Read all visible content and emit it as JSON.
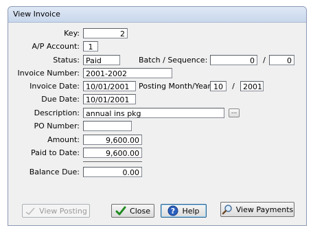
{
  "window": {
    "title": "View Invoice"
  },
  "labels": {
    "key": "Key:",
    "ap_account": "A/P Account:",
    "status": "Status:",
    "batch_sequence": "Batch / Sequence:",
    "slash": "/",
    "invoice_number": "Invoice Number:",
    "invoice_date": "Invoice Date:",
    "posting_month_year": "Posting Month/Year:",
    "due_date": "Due Date:",
    "description": "Description:",
    "po_number": "PO Number:",
    "amount": "Amount:",
    "paid_to_date": "Paid to Date:",
    "balance_due": "Balance Due:"
  },
  "values": {
    "key": "2",
    "ap_account": "1",
    "status": "Paid",
    "batch": "0",
    "sequence": "0",
    "invoice_number": "2001-2002",
    "invoice_date": "10/01/2001",
    "posting_month": "10",
    "posting_year": "2001",
    "due_date": "10/01/2001",
    "description": "annual ins pkg",
    "po_number": "",
    "amount": "9,600.00",
    "paid_to_date": "9,600.00",
    "balance_due": "0.00"
  },
  "buttons": {
    "ellipsis": "...",
    "view_posting": "View Posting",
    "close": "Close",
    "help": "Help",
    "view_payments": "View Payments"
  }
}
